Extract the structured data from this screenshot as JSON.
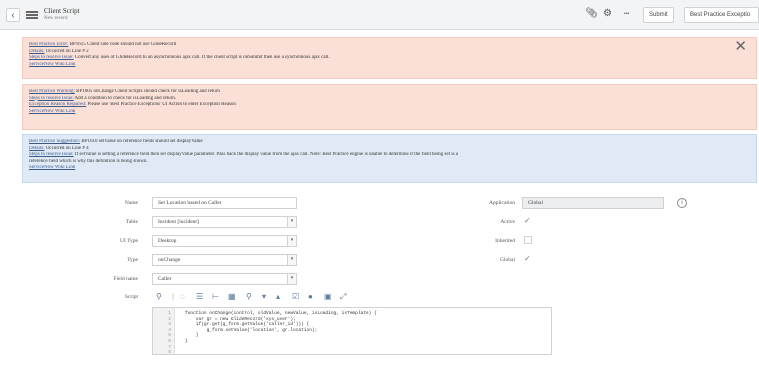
{
  "header": {
    "title": "Client Script",
    "subtitle": "New record",
    "more_label": "•••",
    "submit_label": "Submit",
    "exception_label": "Best Practice Exceptio"
  },
  "banners": [
    {
      "lines": [
        {
          "link": "Best Practice Error:",
          "text": " BP1615 Client side code should not use GlideRecord"
        },
        {
          "link": "Details:",
          "text": " Occurred on Line # 2"
        },
        {
          "link": "Steps to resolve Issue:",
          "text": " Convert any uses of GlideRecord to an asynchronous ajax call. If the client script is onSubmit then use a synchronous ajax call."
        },
        {
          "link": "ServiceNow Wiki Link",
          "text": ""
        }
      ]
    },
    {
      "lines": [
        {
          "link": "Best Practice Warning:",
          "text": " BP1605 onChange Client Scripts should check for isLoading and return"
        },
        {
          "link": "Steps to resolve Issue:",
          "text": " Add a condition to check for isLoading and return."
        },
        {
          "link": "Exception Reason Required:",
          "text": " Please use 'Best Practice Exceptions' UI Action to enter Exception Reason"
        },
        {
          "link": "ServiceNow Wiki Link",
          "text": ""
        }
      ]
    },
    {
      "lines": [
        {
          "link": "Best Practice Suggestion:",
          "text": " BP1610 setValue on reference fields should set displayValue"
        },
        {
          "link": "Details:",
          "text": " Occurred on Line # 4"
        },
        {
          "link": "Steps to resolve Issue:",
          "text": " If setValue is setting a reference field then set displayValue parameter. Pass back the display value from the ajax call. Note: Best Practice engine is unable to determine if the field being set is a"
        },
        {
          "link": "",
          "text": "reference field which is why this definition is being shown."
        },
        {
          "link": "ServiceNow Wiki Link",
          "text": ""
        }
      ]
    }
  ],
  "form": {
    "name_label": "Name",
    "name_value": "Set Location based on Caller",
    "table_label": "Table",
    "table_value": "Incident [incident]",
    "ui_type_label": "UI Type",
    "ui_type_value": "Desktop",
    "type_label": "Type",
    "type_value": "onChange",
    "field_name_label": "Field name",
    "field_name_value": "Caller",
    "script_label": "Script",
    "application_label": "Application",
    "application_value": "Global",
    "active_label": "Active",
    "active_checked": true,
    "inherited_label": "Inherited",
    "inherited_checked": false,
    "global_label": "Global",
    "global_checked": true
  },
  "editor": {
    "line_numbers": "1\n2\n3\n4\n5\n6\n7\n8",
    "code": "function onChange(control, oldValue, newValue, isLoading, isTemplate) {\n    var gr = new GlideRecord('sys_user');\n    if(gr.get(g_form.getValue('caller_id'))) {\n        g_form.setValue('location', gr.location);\n    }\n}"
  },
  "colors": {
    "error_bg": "#fbe0d8",
    "suggestion_bg": "#dfeaf6",
    "link": "#3a5b8c"
  }
}
